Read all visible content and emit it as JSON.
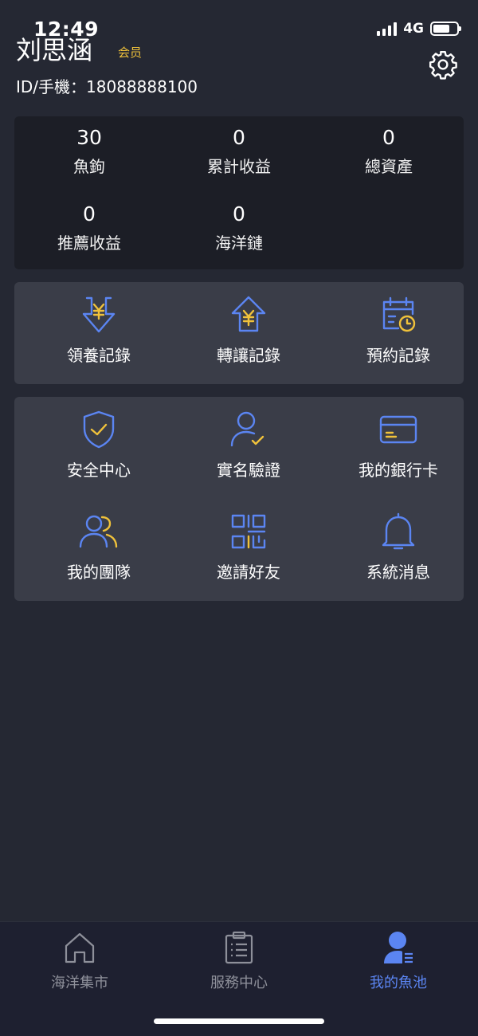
{
  "status_bar": {
    "time": "12:49",
    "network": "4G"
  },
  "profile": {
    "name": "刘思涵",
    "badge": "会员",
    "id_line": "ID/手機：18088888100"
  },
  "stats": [
    {
      "value": "30",
      "label": "魚鉤"
    },
    {
      "value": "0",
      "label": "累計收益"
    },
    {
      "value": "0",
      "label": "總資產"
    },
    {
      "value": "0",
      "label": "推薦收益"
    },
    {
      "value": "0",
      "label": "海洋鏈"
    }
  ],
  "records": [
    {
      "label": "領養記錄",
      "icon": "yen-down-icon"
    },
    {
      "label": "轉讓記錄",
      "icon": "yen-up-icon"
    },
    {
      "label": "預約記錄",
      "icon": "calendar-clock-icon"
    }
  ],
  "services": [
    {
      "label": "安全中心",
      "icon": "shield-check-icon"
    },
    {
      "label": "實名驗證",
      "icon": "user-verify-icon"
    },
    {
      "label": "我的銀行卡",
      "icon": "bank-card-icon"
    },
    {
      "label": "我的團隊",
      "icon": "team-icon"
    },
    {
      "label": "邀請好友",
      "icon": "qr-code-icon"
    },
    {
      "label": "系統消息",
      "icon": "bell-icon"
    }
  ],
  "tabs": [
    {
      "label": "海洋集市",
      "icon": "home-icon",
      "active": false
    },
    {
      "label": "服務中心",
      "icon": "clipboard-icon",
      "active": false
    },
    {
      "label": "我的魚池",
      "icon": "profile-icon",
      "active": true
    }
  ],
  "colors": {
    "background": "#252833",
    "stats_card": "#1c1e26",
    "menu_card": "#3a3d48",
    "icon_blue": "#5b85f2",
    "icon_gold": "#f0c23b",
    "tab_active": "#5b85f2",
    "tab_inactive": "#8e909a"
  }
}
